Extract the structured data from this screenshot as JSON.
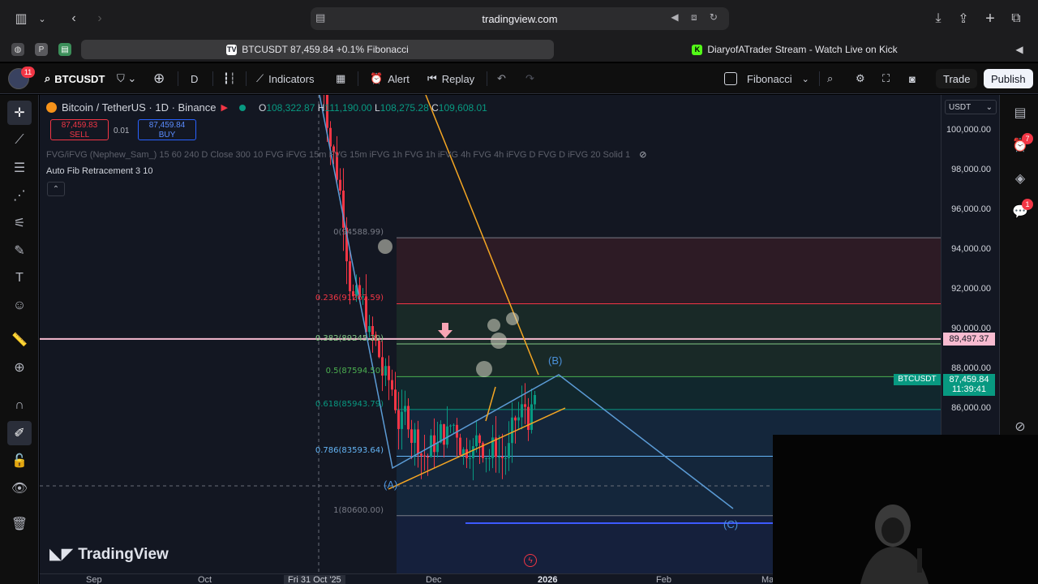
{
  "browser": {
    "url": "tradingview.com"
  },
  "tabs": [
    {
      "label": "BTCUSDT 87,459.84 +0.1% Fibonacci",
      "active": true
    },
    {
      "label": "DiaryofATrader Stream - Watch Live on Kick",
      "active": false
    }
  ],
  "toolbar": {
    "notification_count": "11",
    "symbol": "BTCUSDT",
    "interval": "D",
    "indicators_label": "Indicators",
    "alert_label": "Alert",
    "replay_label": "Replay",
    "layout_name": "Fibonacci",
    "trade_label": "Trade",
    "publish_label": "Publish"
  },
  "legend": {
    "title": "Bitcoin / TetherUS · 1D · Binance",
    "open_k": "O",
    "open": "108,322.87",
    "high_k": "H",
    "high": "111,190.00",
    "low_k": "L",
    "low": "108,275.28",
    "close_k": "C",
    "close": "109,608.01",
    "sell_price": "87,459.83",
    "sell_label": "SELL",
    "buy_price": "87,459.84",
    "buy_label": "BUY",
    "spread": "0.01",
    "indicator_fvg": "FVG/iFVG (Nephew_Sam_) 15 60 240 D Close 300 10 FVG iFVG 15m FVG 15m iFVG 1h FVG 1h iFVG 4h FVG 4h iFVG D FVG D iFVG 20 Solid 1",
    "indicator_fib": "Auto Fib Retracement 3 10"
  },
  "fib_levels": [
    {
      "label": "0(94588.99)",
      "price": 94588.99,
      "color": "#787b86"
    },
    {
      "label": "0.236(91267.59)",
      "price": 91267.59,
      "color": "#f23645"
    },
    {
      "label": "0.382(89245.20)",
      "price": 89245.2,
      "color": "#81c784"
    },
    {
      "label": "0.5(87594.50)",
      "price": 87594.5,
      "color": "#4caf50"
    },
    {
      "label": "0.618(85943.79)",
      "price": 85943.79,
      "color": "#089981"
    },
    {
      "label": "0.786(83593.64)",
      "price": 83593.64,
      "color": "#64b5f6"
    },
    {
      "label": "1(80600.00)",
      "price": 80600.0,
      "color": "#787b86"
    }
  ],
  "waves": {
    "a": "(A)",
    "b": "(B)",
    "c": "(C)"
  },
  "price_scale": {
    "currency": "USDT",
    "ticks": [
      "100,000.00",
      "98,000.00",
      "96,000.00",
      "94,000.00",
      "92,000.00",
      "90,000.00",
      "88,000.00",
      "86,000.00"
    ],
    "line_price": "89,497.37",
    "symbol_tag": "BTCUSDT",
    "last_price": "87,459.84",
    "countdown": "11:39:41"
  },
  "time_axis": {
    "ticks": [
      "Sep",
      "Oct",
      "Fri 31 Oct '25",
      "Dec",
      "2026",
      "Feb",
      "Ma"
    ]
  },
  "brand": {
    "logo_text": "TradingView"
  },
  "right_bar": {
    "alerts_badge": "7",
    "chat_badge": "1"
  },
  "colors": {
    "up": "#089981",
    "down": "#f23645",
    "wave_line": "#5b9bd5",
    "trend_line": "#f5a623",
    "horizontal_line": "#f8bbd0"
  }
}
